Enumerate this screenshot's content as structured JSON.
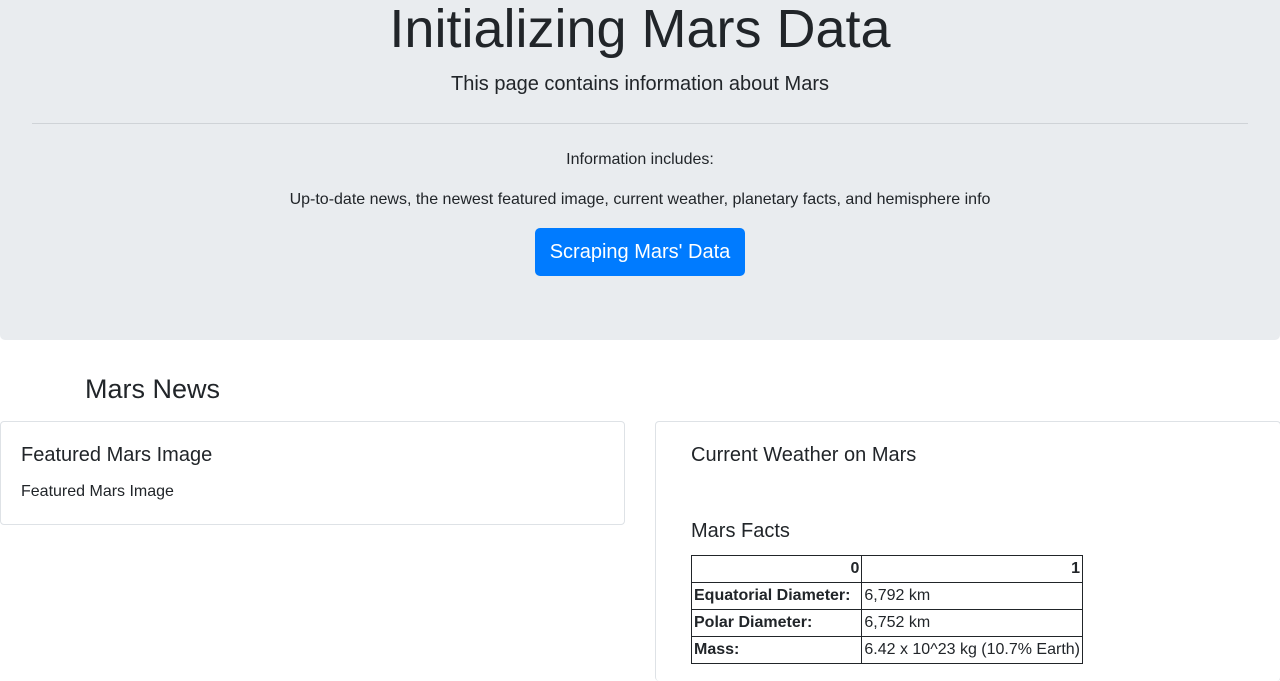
{
  "jumbotron": {
    "title": "Initializing Mars Data",
    "lead": "This page contains information about Mars",
    "info_label": "Information includes:",
    "info_text": "Up-to-date news, the newest featured image, current weather, planetary facts, and hemisphere info",
    "button_label": "Scraping Mars' Data",
    "button_color": "#007bff"
  },
  "news": {
    "heading": "Mars News"
  },
  "featured_image": {
    "title": "Featured Mars Image",
    "alt_text": "Featured Mars Image"
  },
  "weather": {
    "title": "Current Weather on Mars"
  },
  "facts": {
    "title": "Mars Facts",
    "columns": [
      "0",
      "1"
    ],
    "rows": [
      {
        "label": "Equatorial Diameter:",
        "value": "6,792 km"
      },
      {
        "label": "Polar Diameter:",
        "value": "6,752 km"
      },
      {
        "label": "Mass:",
        "value": "6.42 x 10^23 kg (10.7% Earth)"
      }
    ]
  }
}
